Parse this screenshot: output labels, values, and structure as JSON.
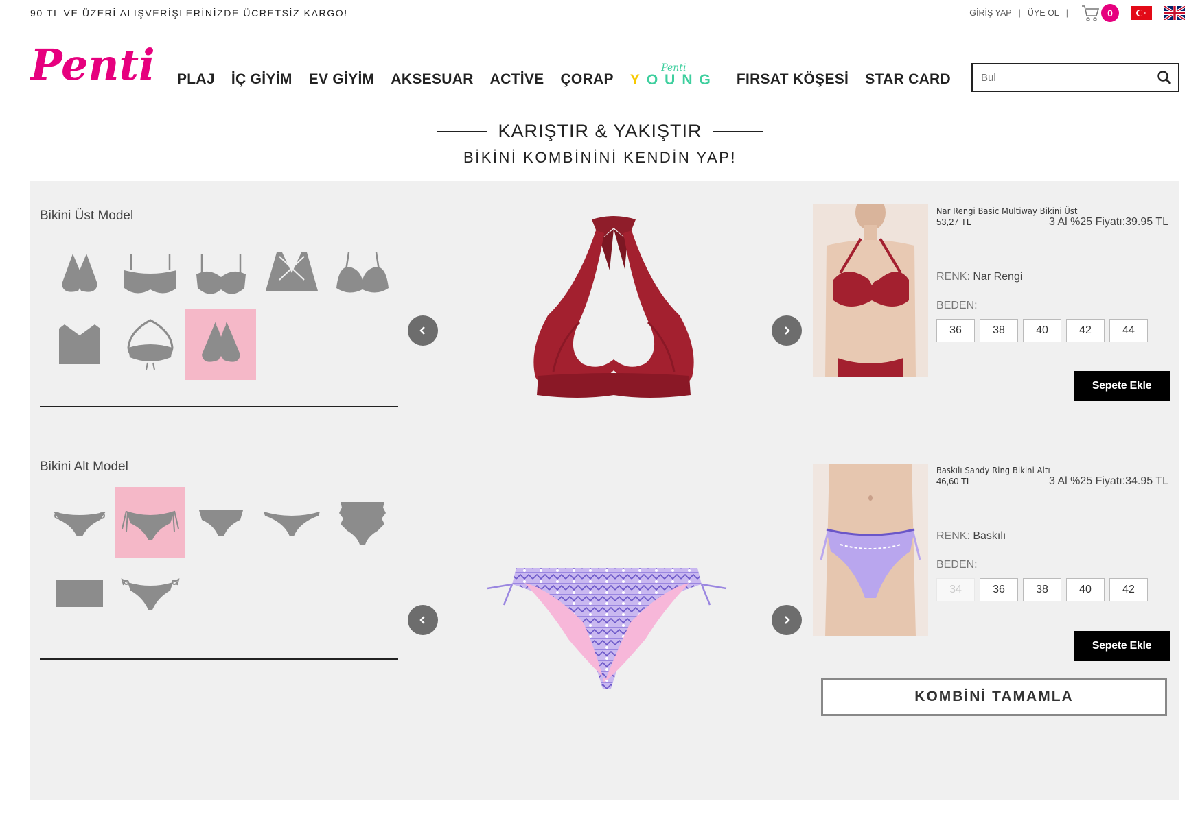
{
  "top_bar": {
    "promo_text": "90 TL VE ÜZERİ ALIŞVERİŞLERİNİZDE ÜCRETSİZ KARGO!",
    "login_label": "GİRİŞ YAP",
    "signup_label": "ÜYE OL",
    "cart_count": "0"
  },
  "header": {
    "logo_text": "Penti",
    "nav_items": [
      "PLAJ",
      "İÇ GİYİM",
      "EV GİYİM",
      "AKSESUAR",
      "ACTİVE",
      "ÇORAP"
    ],
    "young_top": "Penti",
    "young_label": "YOUNG",
    "nav_items_right": [
      "FIRSAT KÖŞESİ",
      "STAR CARD"
    ],
    "search_placeholder": "Bul"
  },
  "heading": {
    "title": "KARIŞTIR & YAKIŞTIR",
    "subtitle": "BİKİNİ KOMBİNİNİ KENDİN YAP!"
  },
  "top_section": {
    "label": "Bikini Üst Model",
    "product": {
      "name": "Nar Rengi Basic Multiway Bikini Üst",
      "price": "53,27 TL",
      "promo": "3 Al %25 Fiyatı:39.95 TL",
      "color_label": "RENK:",
      "color_value": "Nar Rengi",
      "size_label": "BEDEN:",
      "sizes": [
        "36",
        "38",
        "40",
        "42",
        "44"
      ],
      "add_label": "Sepete Ekle"
    }
  },
  "bottom_section": {
    "label": "Bikini Alt Model",
    "product": {
      "name": "Baskılı Sandy Ring Bikini Altı",
      "price": "46,60 TL",
      "promo": "3 Al %25 Fiyatı:34.95 TL",
      "color_label": "RENK:",
      "color_value": "Baskılı",
      "size_label": "BEDEN:",
      "sizes": [
        "34",
        "36",
        "38",
        "40",
        "42"
      ],
      "add_label": "Sepete Ekle"
    }
  },
  "complete_label": "KOMBİNİ TAMAMLA",
  "colors": {
    "brand_pink": "#e6007e",
    "selected_thumb": "#f5b8c8",
    "top_product": "#a3202f",
    "young_green": "#3ecf9e"
  }
}
